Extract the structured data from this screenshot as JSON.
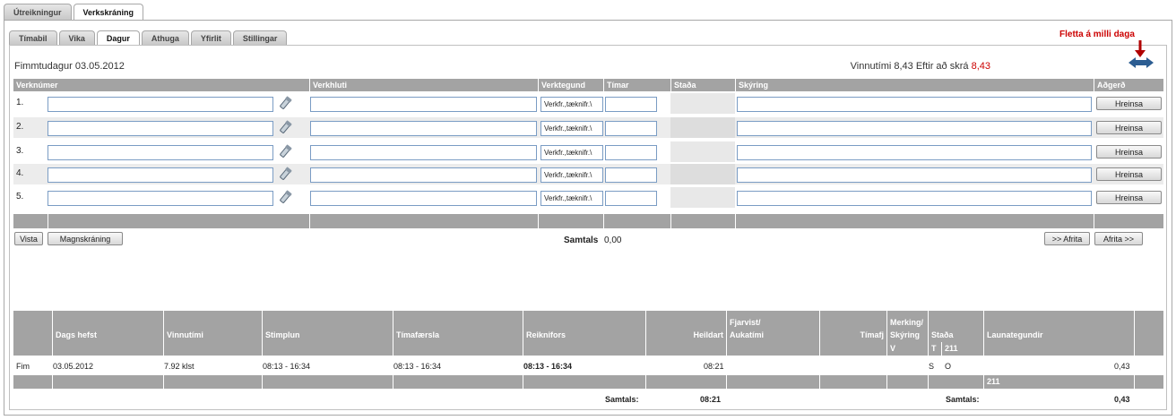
{
  "tabs_main": [
    "Útreikningur",
    "Verkskráning"
  ],
  "tabs_sub": [
    "Tímabil",
    "Vika",
    "Dagur",
    "Athuga",
    "Yfirlit",
    "Stillingar"
  ],
  "active_main": "Verkskráning",
  "active_sub": "Dagur",
  "fletta_label": "Fletta á milli daga",
  "day_label": "Fimmtudagur 03.05.2012",
  "work_info": {
    "text": "Vinnutími 8,43 Eftir að skrá",
    "remaining": "8,43"
  },
  "entry_headers": {
    "verknumer": "Verknúmer",
    "verkhluti": "Verkhluti",
    "verktegund": "Verktegund",
    "timar": "Tímar",
    "stada": "Staða",
    "skyring": "Skýring",
    "adgerd": "Aðgerð"
  },
  "entry_rows": [
    {
      "num": "1.",
      "verktegund": "Verkfr.,tæknifr.\\"
    },
    {
      "num": "2.",
      "verktegund": "Verkfr.,tæknifr.\\"
    },
    {
      "num": "3.",
      "verktegund": "Verkfr.,tæknifr.\\"
    },
    {
      "num": "4.",
      "verktegund": "Verkfr.,tæknifr.\\"
    },
    {
      "num": "5.",
      "verktegund": "Verkfr.,tæknifr.\\"
    }
  ],
  "hreinsa_label": "Hreinsa",
  "buttons": {
    "vista": "Vista",
    "magnskraning": "Magnskráning",
    "afrita_back": ">> Afrita",
    "afrita_fwd": "Afrita >>"
  },
  "entry_total": {
    "label": "Samtals",
    "value": "0,00"
  },
  "summary_headers": {
    "dags_hefst": "Dags hefst",
    "vinnutimi": "Vinnutími",
    "stimplun": "Stimplun",
    "timafaersla": "Tímafærsla",
    "reiknifors": "Reiknifors",
    "heildart": "Heildart",
    "fjarvist_1": "Fjarvist/",
    "fjarvist_2": "Aukatími",
    "timafj": "Tímafj",
    "merking_1": "Merking/",
    "merking_2": "Skýring",
    "stada": "Staða",
    "launategundir": "Launategundir"
  },
  "summary_sub": {
    "v": "V",
    "t": "T",
    "code": "211"
  },
  "summary_row": {
    "day": "Fim",
    "date": "03.05.2012",
    "vinnutimi": "7.92 klst",
    "stimplun": "08:13 - 16:34",
    "timafaersla": "08:13 - 16:34",
    "reiknifors": "08:13 - 16:34",
    "heildart": "08:21",
    "s": "S",
    "o": "O",
    "value": "0,43"
  },
  "summary_gray_code": "211",
  "summary_totals": {
    "label1": "Samtals:",
    "value1": "08:21",
    "label2": "Samtals:",
    "value2": "0,43"
  },
  "colors": {
    "header_gray": "#a3a3a3",
    "accent_red": "#cc0000",
    "input_border": "#7a9cc4"
  }
}
